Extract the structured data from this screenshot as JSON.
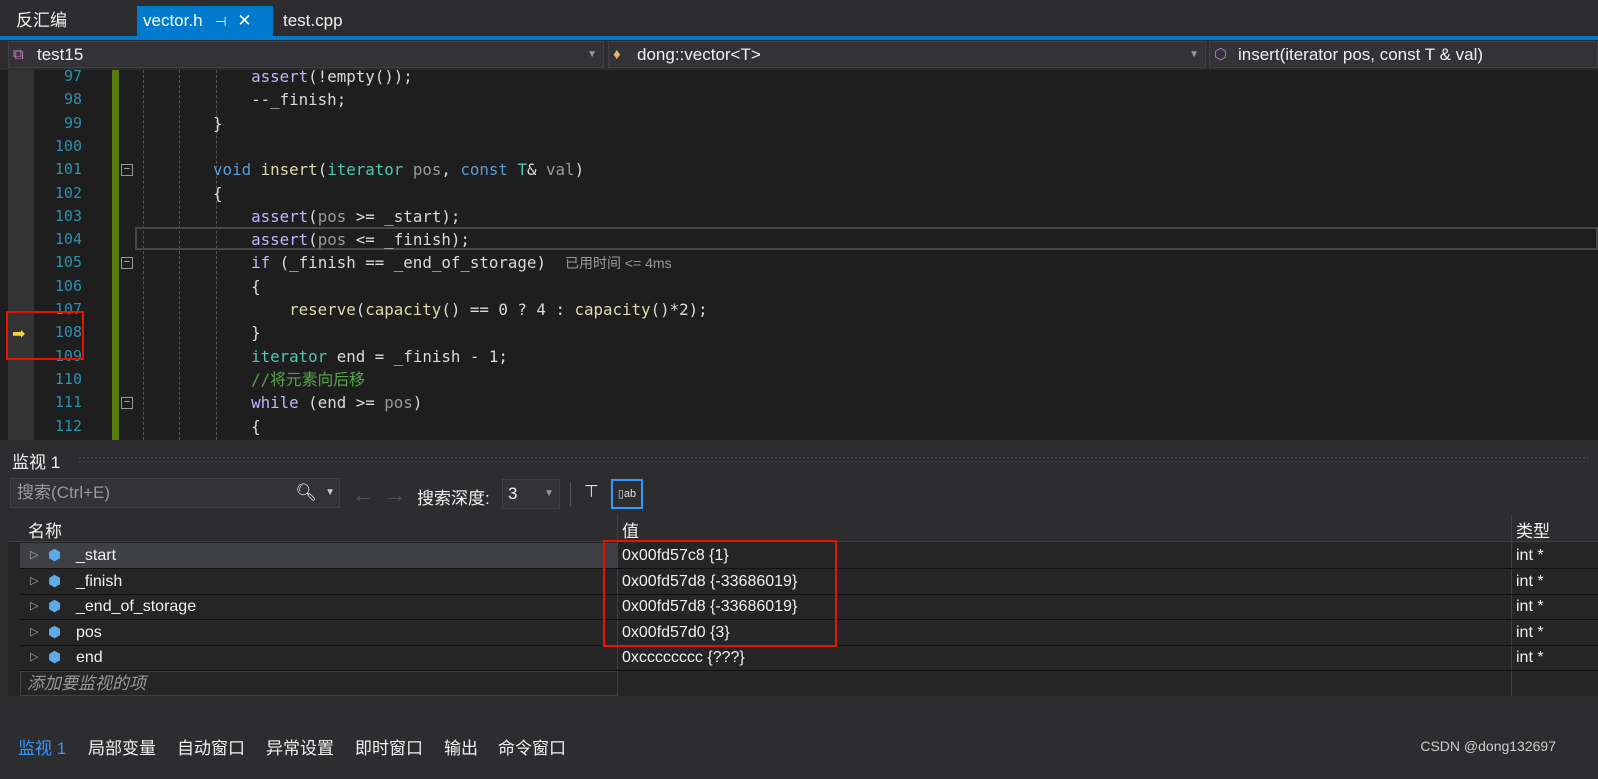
{
  "tabs": [
    {
      "label": "反汇编"
    },
    {
      "label": "vector.h",
      "active": true,
      "pin": "⊣",
      "close": "✕"
    },
    {
      "label": "test.cpp"
    }
  ],
  "navbar": {
    "project": "test15",
    "scope": "dong::vector<T>",
    "member": "insert(iterator pos, const T & val)"
  },
  "editor": {
    "current_line": 105,
    "lines": [
      {
        "n": "97",
        "t": [
          [
            "        ",
            ""
          ],
          [
            "assert",
            "mc"
          ],
          [
            "(!empty());",
            ""
          ]
        ]
      },
      {
        "n": "98",
        "t": [
          [
            "        --",
            ""
          ],
          [
            "_finish",
            "mb"
          ],
          [
            ";",
            ""
          ]
        ]
      },
      {
        "n": "99",
        "t": [
          [
            "    }",
            ""
          ]
        ]
      },
      {
        "n": "100",
        "t": []
      },
      {
        "n": "101",
        "t": [
          [
            "    ",
            ""
          ],
          [
            "void",
            "kw"
          ],
          [
            " ",
            ""
          ],
          [
            "insert",
            "fn"
          ],
          [
            "(",
            ""
          ],
          [
            "iterator",
            "ty"
          ],
          [
            " ",
            ""
          ],
          [
            "pos",
            "pa"
          ],
          [
            ", ",
            ""
          ],
          [
            "const",
            "kw"
          ],
          [
            " ",
            ""
          ],
          [
            "T",
            "ty"
          ],
          [
            "& ",
            ""
          ],
          [
            "val",
            "pa"
          ],
          [
            ")",
            ""
          ]
        ]
      },
      {
        "n": "102",
        "t": [
          [
            "    {",
            ""
          ]
        ]
      },
      {
        "n": "103",
        "t": [
          [
            "        ",
            ""
          ],
          [
            "assert",
            "mc"
          ],
          [
            "(",
            ""
          ],
          [
            "pos",
            "pa"
          ],
          [
            " >= ",
            ""
          ],
          [
            "_start",
            "mb"
          ],
          [
            ");",
            ""
          ]
        ]
      },
      {
        "n": "104",
        "t": [
          [
            "        ",
            ""
          ],
          [
            "assert",
            "mc"
          ],
          [
            "(",
            ""
          ],
          [
            "pos",
            "pa"
          ],
          [
            " <= ",
            ""
          ],
          [
            "_finish",
            "mb"
          ],
          [
            ");",
            ""
          ]
        ]
      },
      {
        "n": "105",
        "t": [
          [
            "        ",
            ""
          ],
          [
            "if",
            "mc"
          ],
          [
            " (",
            ""
          ],
          [
            "_finish",
            "mb"
          ],
          [
            " == ",
            ""
          ],
          [
            "_end_of_storage",
            "mb"
          ],
          [
            ")  ",
            ""
          ],
          [
            "已用时间 <= 4ms",
            "hint"
          ]
        ]
      },
      {
        "n": "106",
        "t": [
          [
            "        {",
            ""
          ]
        ]
      },
      {
        "n": "107",
        "t": [
          [
            "            ",
            ""
          ],
          [
            "reserve",
            "fn"
          ],
          [
            "(",
            ""
          ],
          [
            "capacity",
            "fn"
          ],
          [
            "() == 0 ? 4 : ",
            ""
          ],
          [
            "capacity",
            "fn"
          ],
          [
            "()*2);",
            ""
          ]
        ]
      },
      {
        "n": "108",
        "t": [
          [
            "        }",
            ""
          ]
        ]
      },
      {
        "n": "109",
        "t": [
          [
            "        ",
            ""
          ],
          [
            "iterator",
            "ty"
          ],
          [
            " ",
            ""
          ],
          [
            "end",
            "mb"
          ],
          [
            " = ",
            ""
          ],
          [
            "_finish",
            "mb"
          ],
          [
            " - 1;",
            ""
          ]
        ]
      },
      {
        "n": "110",
        "t": [
          [
            "        ",
            ""
          ],
          [
            "//将元素向后移",
            "cm"
          ]
        ]
      },
      {
        "n": "111",
        "t": [
          [
            "        ",
            ""
          ],
          [
            "while",
            "mc"
          ],
          [
            " (",
            ""
          ],
          [
            "end",
            "mb"
          ],
          [
            " >= ",
            ""
          ],
          [
            "pos",
            "pa"
          ],
          [
            ")",
            ""
          ]
        ]
      },
      {
        "n": "112",
        "t": [
          [
            "        {",
            ""
          ]
        ]
      }
    ]
  },
  "watch": {
    "title": "监视 1",
    "search_placeholder": "搜索(Ctrl+E)",
    "depth_label": "搜索深度:",
    "depth_value": "3",
    "columns": {
      "name": "名称",
      "value": "值",
      "type": "类型"
    },
    "rows": [
      {
        "name": "_start",
        "value": "0x00fd57c8 {1}",
        "type": "int *",
        "icon": "private-field-icon"
      },
      {
        "name": "_finish",
        "value": "0x00fd57d8 {-33686019}",
        "type": "int *",
        "icon": "private-field-icon"
      },
      {
        "name": "_end_of_storage",
        "value": "0x00fd57d8 {-33686019}",
        "type": "int *",
        "icon": "private-field-icon"
      },
      {
        "name": "pos",
        "value": "0x00fd57d0 {3}",
        "type": "int *",
        "icon": "local-variable-icon"
      },
      {
        "name": "end",
        "value": "0xcccccccc {???}",
        "type": "int *",
        "icon": "local-variable-icon"
      }
    ],
    "add_placeholder": "添加要监视的项"
  },
  "bottom_tabs": [
    {
      "label": "监视 1",
      "active": true
    },
    {
      "label": "局部变量"
    },
    {
      "label": "自动窗口"
    },
    {
      "label": "异常设置"
    },
    {
      "label": "即时窗口"
    },
    {
      "label": "输出"
    },
    {
      "label": "命令窗口"
    }
  ],
  "watermark": "CSDN @dong132697",
  "colors": {
    "accent": "#007acc",
    "highlight": "#e51400",
    "line_number": "#2b91af"
  }
}
